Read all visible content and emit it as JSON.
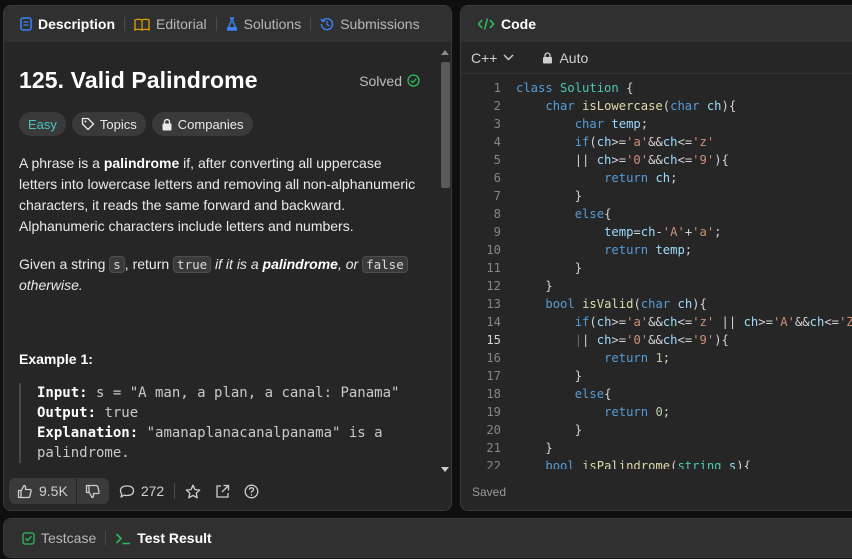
{
  "left_tabs": [
    {
      "label": "Description",
      "icon": "description-icon"
    },
    {
      "label": "Editorial",
      "icon": "book-icon"
    },
    {
      "label": "Solutions",
      "icon": "flask-icon"
    },
    {
      "label": "Submissions",
      "icon": "history-icon"
    }
  ],
  "problem": {
    "title": "125. Valid Palindrome",
    "status": "Solved",
    "badges": {
      "difficulty": "Easy",
      "topics": "Topics",
      "companies": "Companies"
    },
    "p1": {
      "a": "A phrase is a ",
      "b": "palindrome",
      "c": " if, after converting all uppercase letters into lowercase letters and removing all non-alphanumeric characters, it reads the same forward and backward. Alphanumeric characters include letters and numbers."
    },
    "p2": {
      "a": "Given a string ",
      "code_s": "s",
      "b": ", return ",
      "code_true": "true",
      "c": " if it is a ",
      "d": "palindrome",
      "e": ", or ",
      "code_false": "false",
      "f": " otherwise."
    },
    "example_heading": "Example 1:",
    "example": {
      "input_label": "Input:",
      "input_value": " s = \"A man, a plan, a canal: Panama\"",
      "output_label": "Output:",
      "output_value": " true",
      "explanation_label": "Explanation:",
      "explanation_value": " \"amanaplanacanalpanama\" is a palindrome."
    }
  },
  "footer": {
    "likes": "9.5K",
    "comments": "272"
  },
  "code_panel": {
    "title": "Code",
    "language": "C++",
    "mode": "Auto",
    "status": "Saved",
    "current_line": 15
  },
  "bottom_tabs": [
    {
      "label": "Testcase"
    },
    {
      "label": "Test Result"
    }
  ]
}
